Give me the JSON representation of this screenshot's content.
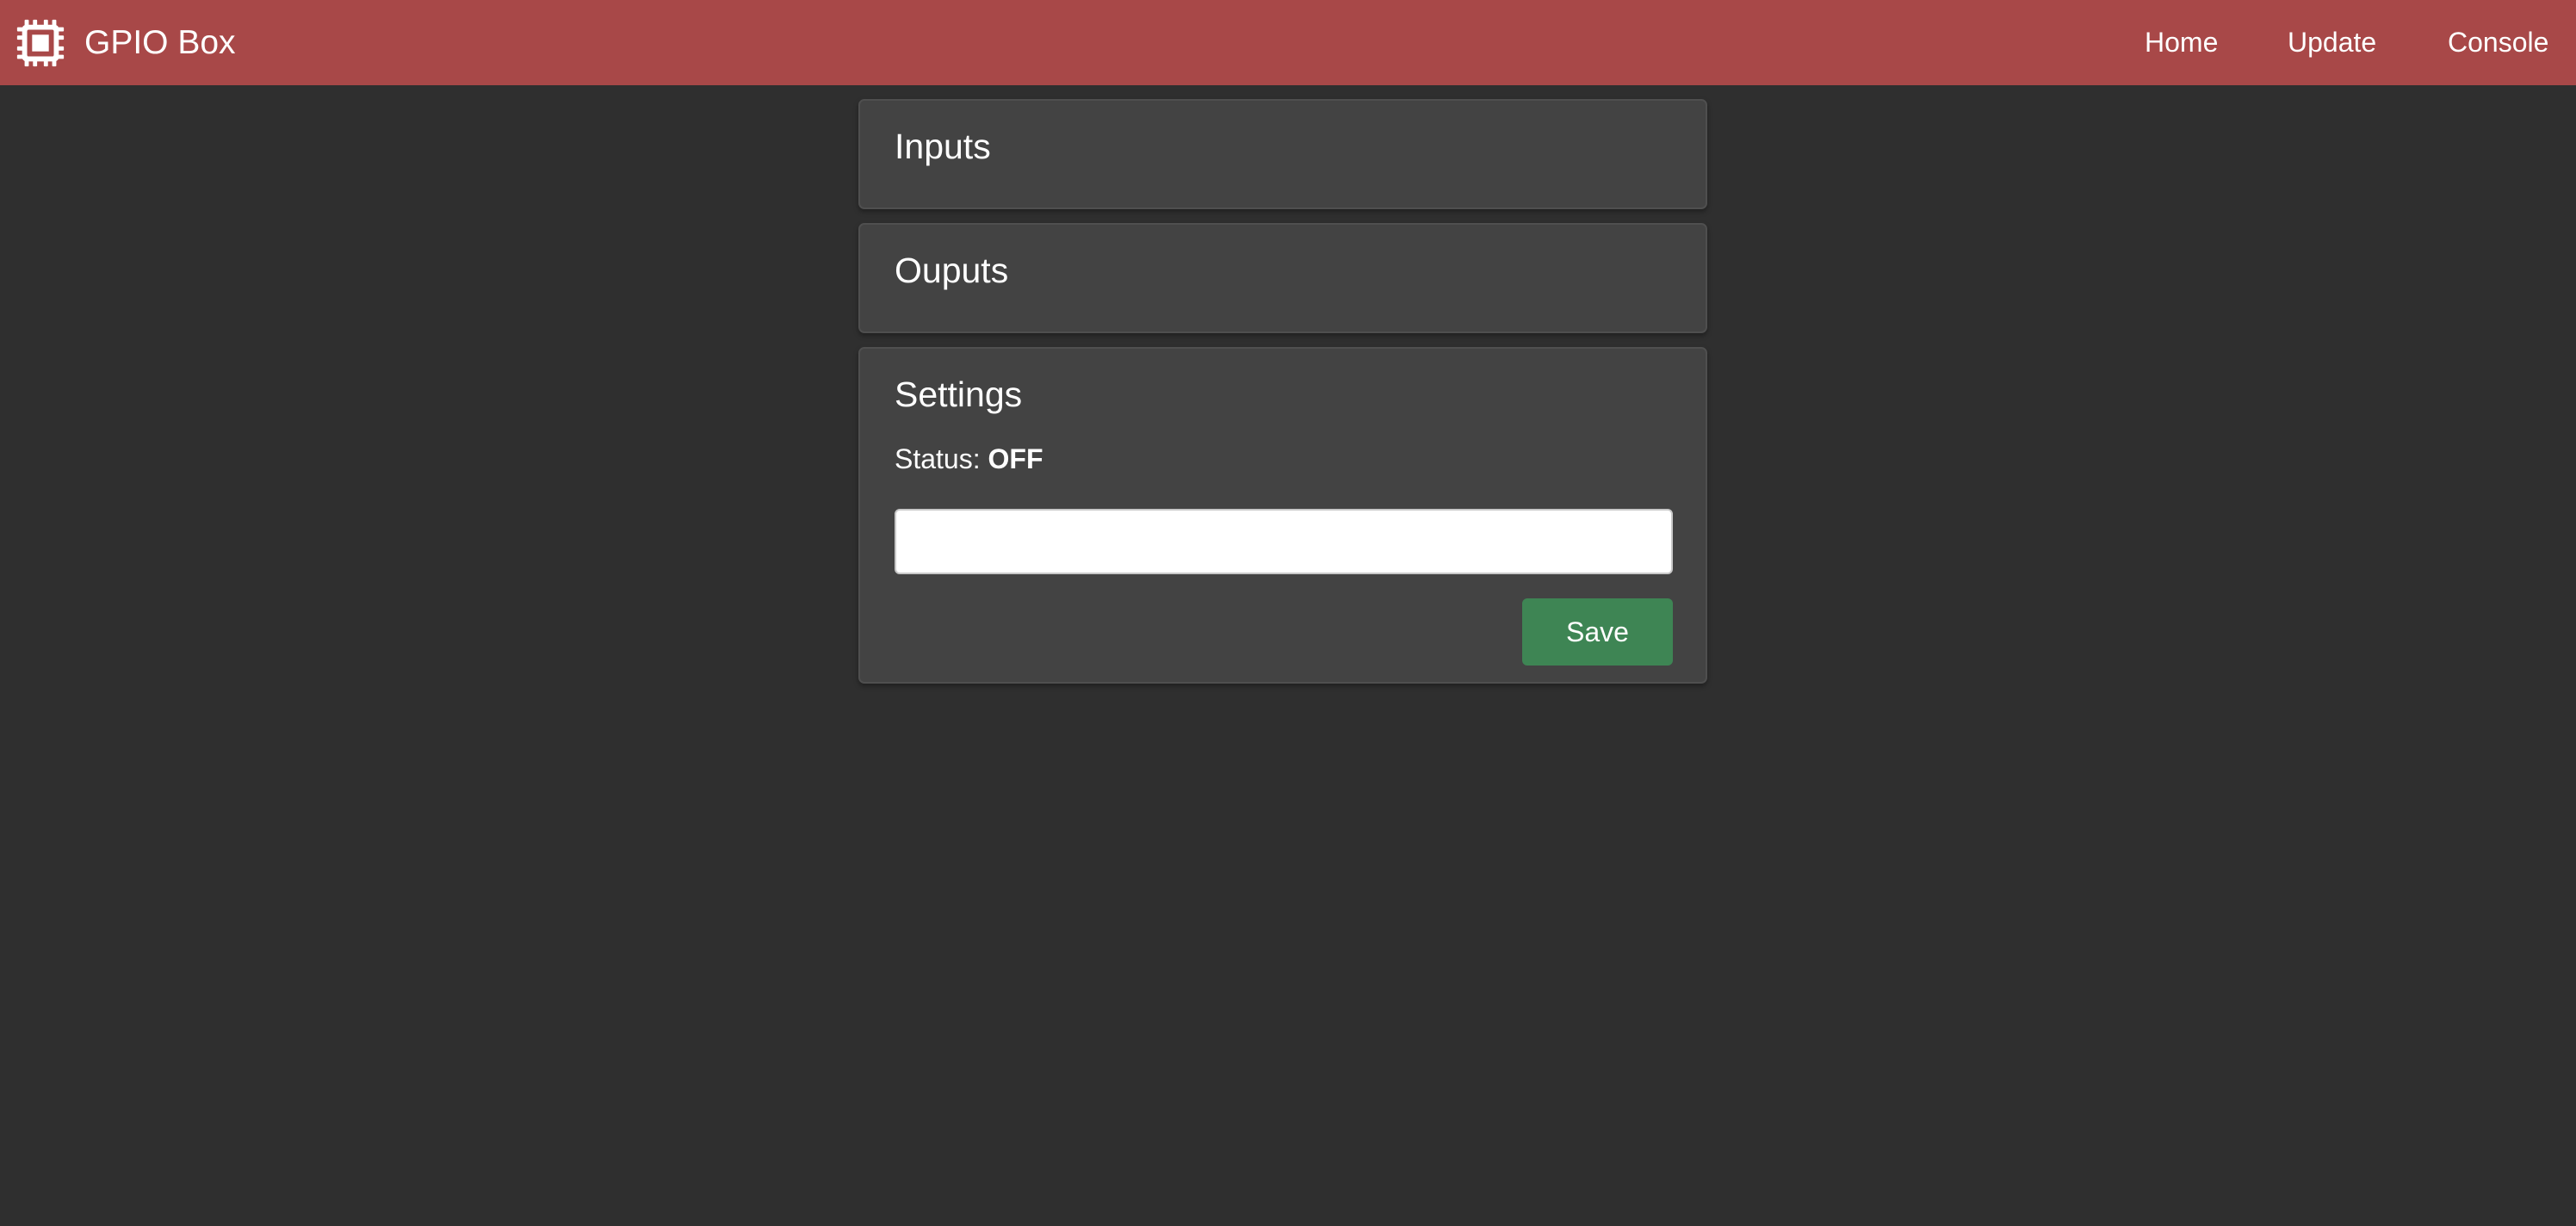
{
  "navbar": {
    "brand_icon": "cpu-chip-icon",
    "brand_title": "GPIO Box",
    "background_color": "#a84848",
    "links": [
      {
        "label": "Home"
      },
      {
        "label": "Update"
      },
      {
        "label": "Console"
      }
    ]
  },
  "cards": {
    "inputs": {
      "title": "Inputs"
    },
    "outputs": {
      "title": "Ouputs"
    },
    "settings": {
      "title": "Settings",
      "status_label": "Status:",
      "status_value": "OFF",
      "input_value": "",
      "input_placeholder": "",
      "save_label": "Save",
      "save_color": "#3e8554"
    }
  },
  "colors": {
    "page_background": "#2f2f2f",
    "card_background": "#434343"
  }
}
